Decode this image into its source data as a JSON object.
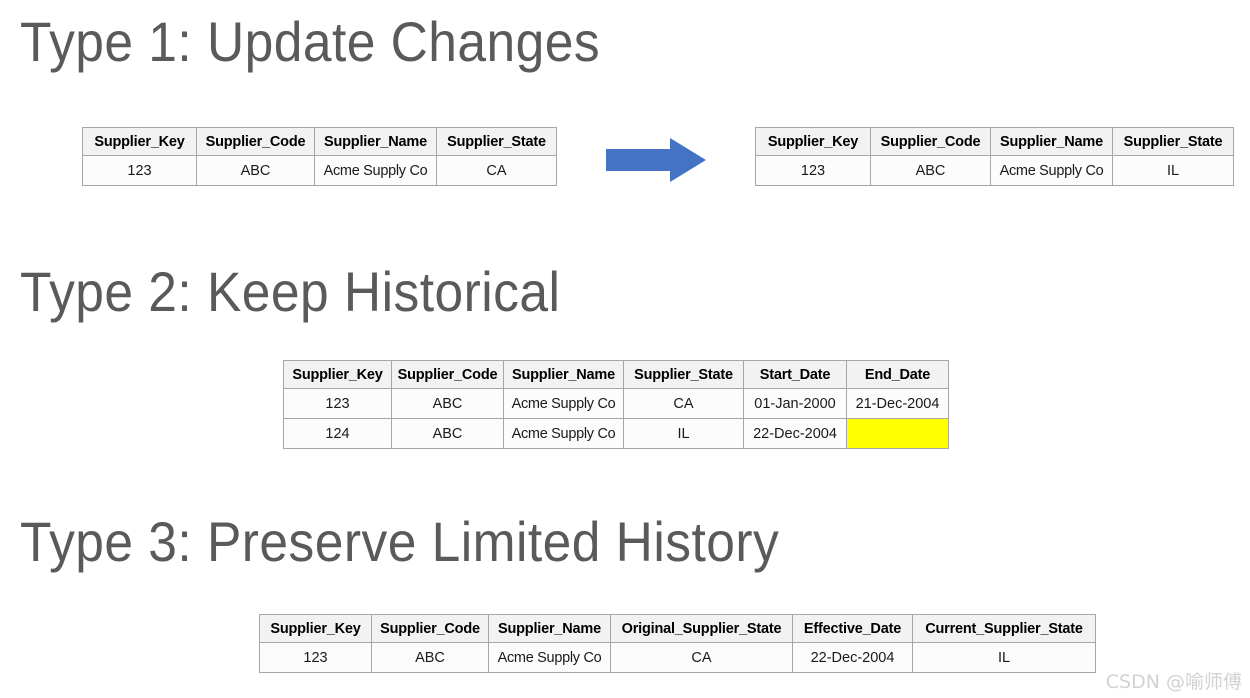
{
  "page": {
    "background_color": "#FFFFFF",
    "heading_color": "#5A5A5A",
    "accent_color": "#4472C4",
    "highlight_color": "#FFFF00",
    "border_color": "#A6A6A6",
    "header_fill_color": "#F2F2F2"
  },
  "sections": [
    {
      "id": "type1",
      "heading": "Type 1: Update Changes",
      "arrow": {
        "icon": "right-arrow-icon",
        "color": "#4472C4"
      },
      "tables": [
        {
          "id": "before",
          "columns": [
            "Supplier_Key",
            "Supplier_Code",
            "Supplier_Name",
            "Supplier_State"
          ],
          "rows": [
            [
              "123",
              "ABC",
              "Acme Supply Co",
              "CA"
            ]
          ]
        },
        {
          "id": "after",
          "columns": [
            "Supplier_Key",
            "Supplier_Code",
            "Supplier_Name",
            "Supplier_State"
          ],
          "rows": [
            [
              "123",
              "ABC",
              "Acme Supply Co",
              "IL"
            ]
          ]
        }
      ]
    },
    {
      "id": "type2",
      "heading": "Type 2: Keep Historical",
      "tables": [
        {
          "id": "history",
          "columns": [
            "Supplier_Key",
            "Supplier_Code",
            "Supplier_Name",
            "Supplier_State",
            "Start_Date",
            "End_Date"
          ],
          "rows": [
            [
              "123",
              "ABC",
              "Acme Supply Co",
              "CA",
              "01-Jan-2000",
              "21-Dec-2004"
            ],
            [
              "124",
              "ABC",
              "Acme Supply Co",
              "IL",
              "22-Dec-2004",
              ""
            ]
          ],
          "highlighted_cells": [
            {
              "row": 1,
              "col": 5
            }
          ]
        }
      ]
    },
    {
      "id": "type3",
      "heading": "Type 3: Preserve Limited History",
      "tables": [
        {
          "id": "limited",
          "columns": [
            "Supplier_Key",
            "Supplier_Code",
            "Supplier_Name",
            "Original_Supplier_State",
            "Effective_Date",
            "Current_Supplier_State"
          ],
          "rows": [
            [
              "123",
              "ABC",
              "Acme Supply Co",
              "CA",
              "22-Dec-2004",
              "IL"
            ]
          ]
        }
      ]
    }
  ],
  "watermark": {
    "text": "CSDN @喻师傅"
  }
}
